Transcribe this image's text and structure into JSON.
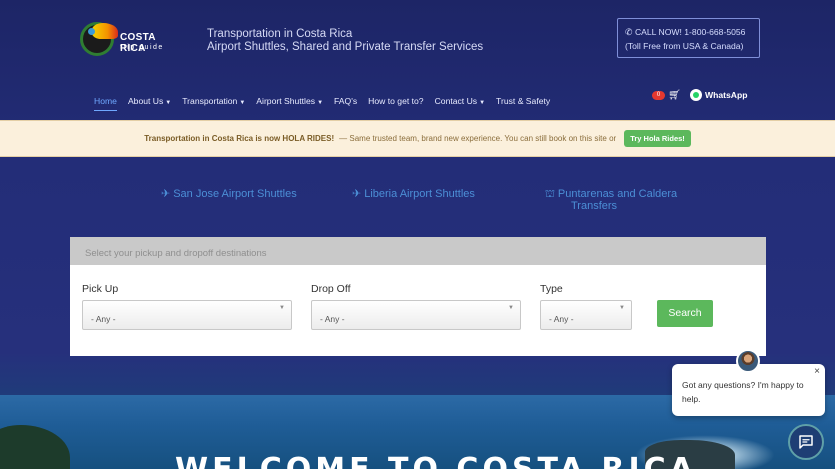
{
  "header": {
    "logo_brand": "COSTA RICA",
    "logo_sub": "trip guide",
    "tagline_line1": "Transportation in Costa Rica",
    "tagline_line2": "Airport Shuttles, Shared and Private Transfer Services",
    "call_line1": "CALL NOW! 1-800-668-5056",
    "call_line2": "(Toll Free from USA & Canada)"
  },
  "nav": {
    "items": [
      {
        "label": "Home",
        "active": true
      },
      {
        "label": "About Us",
        "dropdown": true
      },
      {
        "label": "Transportation",
        "dropdown": true
      },
      {
        "label": "Airport Shuttles",
        "dropdown": true
      },
      {
        "label": "FAQ's"
      },
      {
        "label": "How to get to?"
      },
      {
        "label": "Contact Us",
        "dropdown": true
      },
      {
        "label": "Trust & Safety"
      }
    ],
    "cart_count": "0",
    "whatsapp_label": "WhatsApp"
  },
  "banner": {
    "bold_text": "Transportation in Costa Rica is now HOLA RIDES!",
    "text": " — Same trusted team, brand new experience. You can still book on this site or",
    "button_label": "Try Hola Rides!"
  },
  "routes": [
    {
      "label": "San Jose Airport Shuttles",
      "icon": "plane-icon"
    },
    {
      "label": "Liberia Airport Shuttles",
      "icon": "plane-icon"
    },
    {
      "label_line1": "Puntarenas and Caldera",
      "label_line2": "Transfers",
      "icon": "landmark-icon"
    }
  ],
  "search": {
    "heading": "Select your pickup and dropoff destinations",
    "pickup_label": "Pick Up",
    "pickup_value": "- Any -",
    "dropoff_label": "Drop Off",
    "dropoff_value": "- Any -",
    "type_label": "Type",
    "type_value": "- Any -",
    "button_label": "Search"
  },
  "hero": {
    "welcome": "WELCOME TO COSTA RICA"
  },
  "chat": {
    "message": "Got any questions? I'm happy to help.",
    "close": "×"
  },
  "colors": {
    "background": "#232d78",
    "accent_green": "#5cb85c",
    "link_blue": "#4c8fd6",
    "banner_bg": "#fbf0dc"
  }
}
